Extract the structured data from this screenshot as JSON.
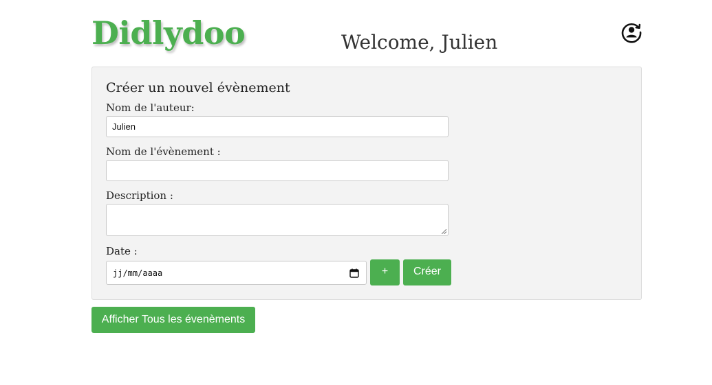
{
  "header": {
    "logo": "Didlydoo",
    "welcome": "Welcome, Julien",
    "account_icon": "user-circle-refresh-icon"
  },
  "form": {
    "title": "Créer un nouvel évènement",
    "author_label": "Nom de l'auteur:",
    "author_value": "Julien",
    "event_name_label": "Nom de l'évènement :",
    "event_name_value": "",
    "description_label": "Description :",
    "description_value": "",
    "date_label": "Date :",
    "date_placeholder": "jj/mm/aaaa",
    "calendar_icon": "calendar-icon",
    "add_date_label": "+",
    "create_label": "Créer"
  },
  "actions": {
    "show_all_label": "Afficher Tous les évenèments"
  },
  "colors": {
    "accent": "#4caf50",
    "panel_bg": "#f3f3f3",
    "panel_border": "#dddddd"
  }
}
